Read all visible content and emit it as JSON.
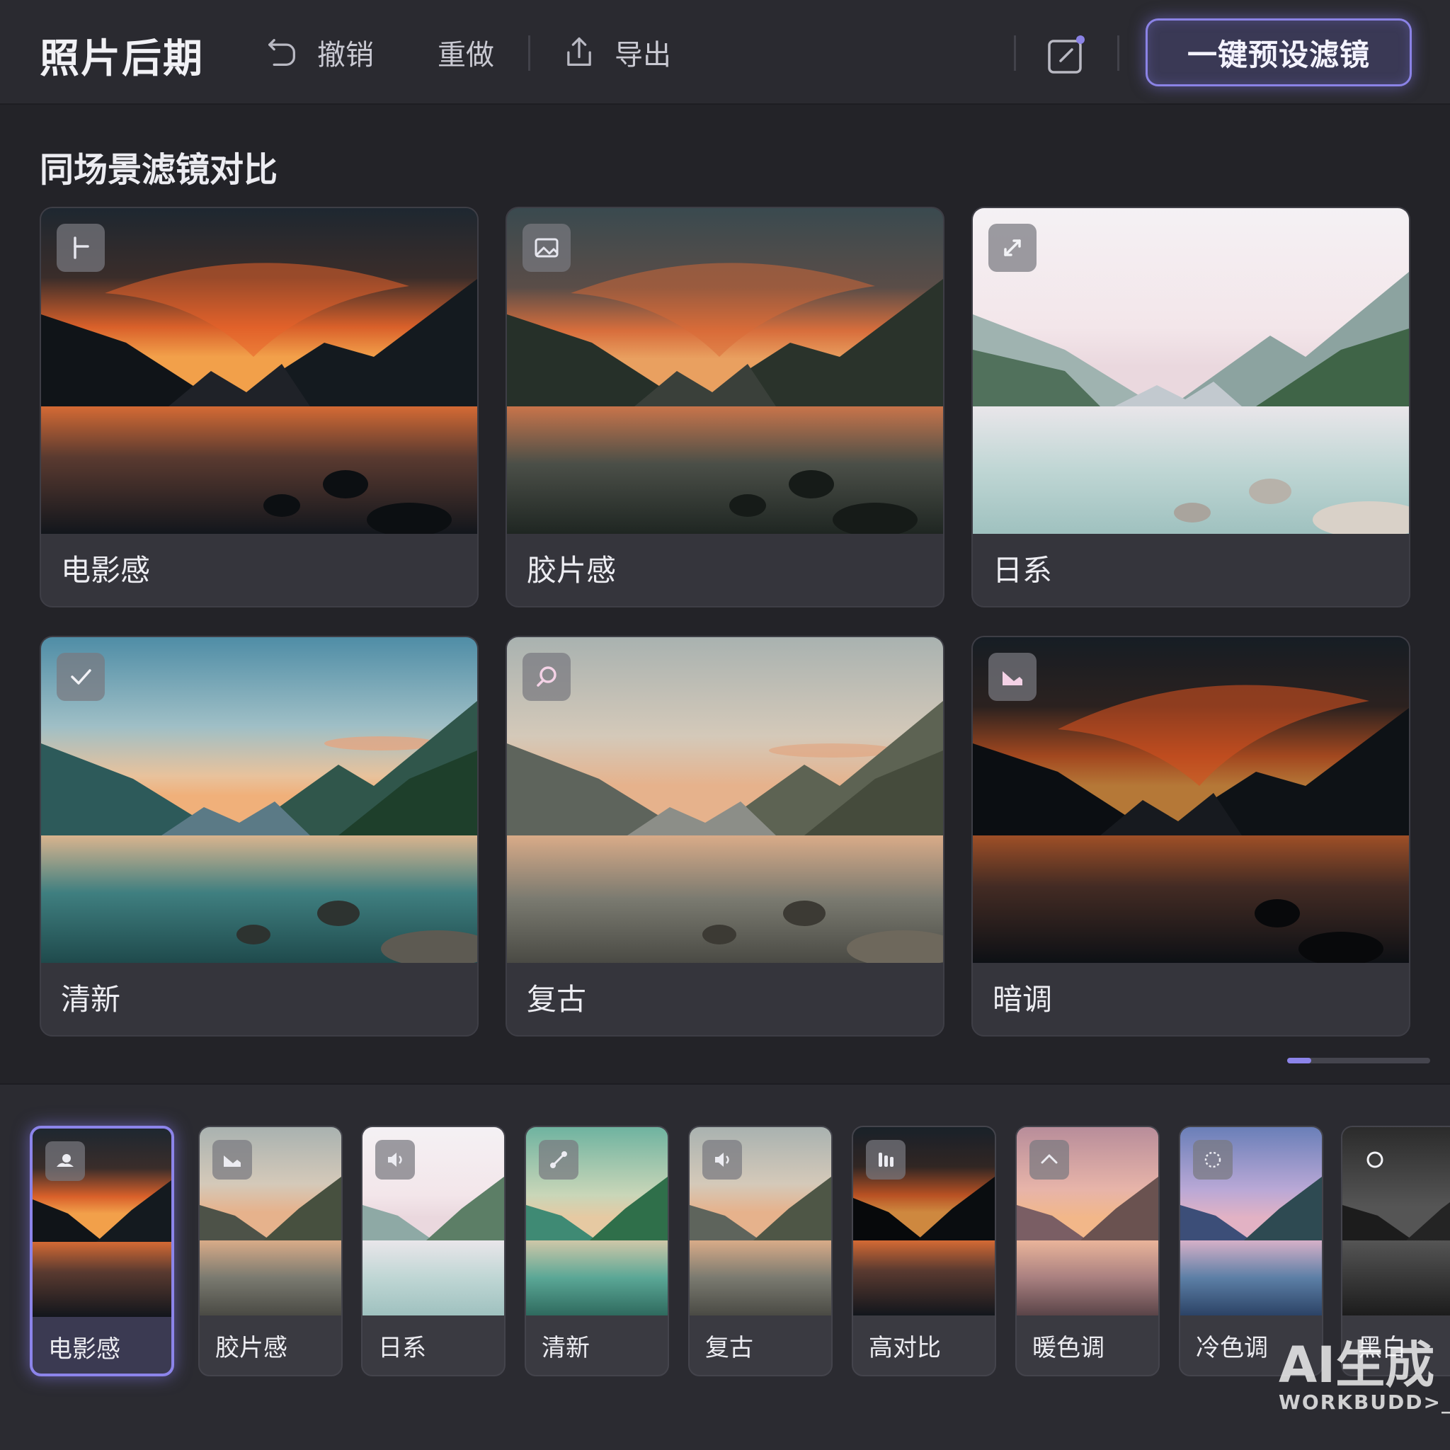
{
  "header": {
    "title": "照片后期",
    "undo_label": "撤销",
    "redo_label": "重做",
    "export_label": "导出",
    "preset_button": "一键预设滤镜",
    "accent": "#8b83e6"
  },
  "section": {
    "title": "同场景滤镜对比"
  },
  "filter_cards": [
    {
      "label": "电影感",
      "icon": "crop-icon",
      "style": "cinematic"
    },
    {
      "label": "胶片感",
      "icon": "image-icon",
      "style": "film"
    },
    {
      "label": "日系",
      "icon": "expand-icon",
      "style": "japanese"
    },
    {
      "label": "清新",
      "icon": "check-icon",
      "style": "fresh"
    },
    {
      "label": "复古",
      "icon": "search-icon",
      "style": "retro"
    },
    {
      "label": "暗调",
      "icon": "landscape-icon",
      "style": "dark"
    }
  ],
  "scroll": {
    "position": 0.17
  },
  "thumbnails": [
    {
      "label": "电影感",
      "icon": "weather-icon",
      "selected": true
    },
    {
      "label": "胶片感",
      "icon": "landscape-icon",
      "selected": false
    },
    {
      "label": "日系",
      "icon": "sound-icon",
      "selected": false
    },
    {
      "label": "清新",
      "icon": "brush-icon",
      "selected": false
    },
    {
      "label": "复古",
      "icon": "sound-icon",
      "selected": false
    },
    {
      "label": "高对比",
      "icon": "bars-icon",
      "selected": false
    },
    {
      "label": "暖色调",
      "icon": "chevron-up-icon",
      "selected": false
    },
    {
      "label": "冷色调",
      "icon": "dashed-circle-icon",
      "selected": false
    },
    {
      "label": "黑白",
      "icon": "circle-icon",
      "selected": false
    }
  ],
  "watermark": {
    "line1": "AI生成",
    "line2": "WORKBUDD>_"
  }
}
